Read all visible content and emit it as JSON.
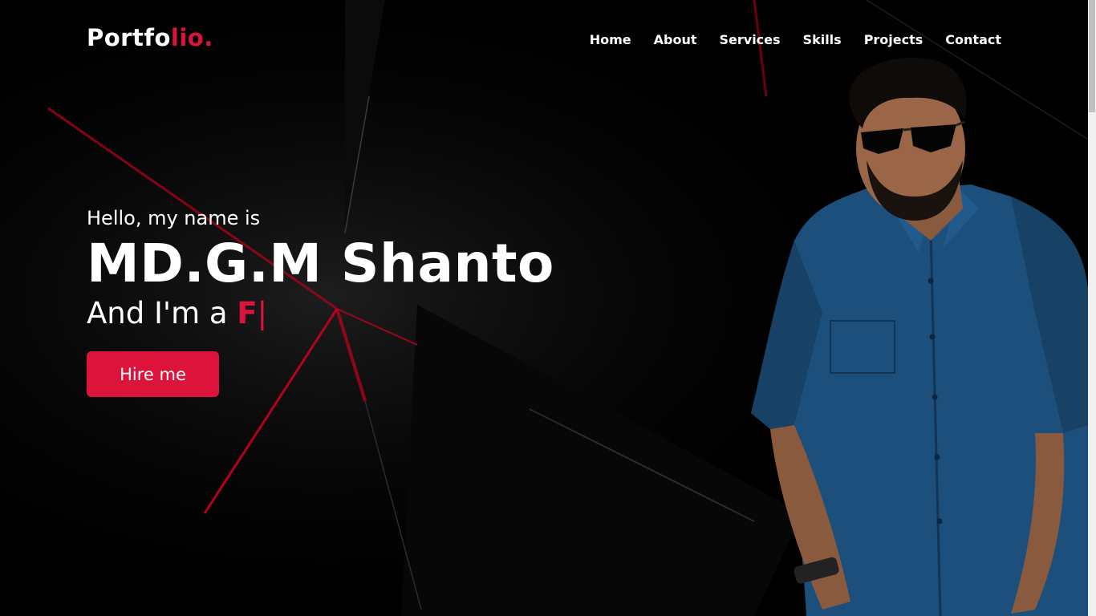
{
  "logo": {
    "text": "Portfo",
    "accent": "lio."
  },
  "nav": {
    "items": [
      "Home",
      "About",
      "Services",
      "Skills",
      "Projects",
      "Contact"
    ]
  },
  "hero": {
    "greeting": "Hello, my name is",
    "name": "MD.G.M Shanto",
    "role_prefix": "And I'm a ",
    "role_typed": "F",
    "cursor": "|",
    "hire_button": "Hire me"
  },
  "colors": {
    "accent": "#dc143c",
    "background": "#000000",
    "shirt": "#1d4f7c"
  },
  "icons": {
    "hero_image": "person-photo"
  }
}
